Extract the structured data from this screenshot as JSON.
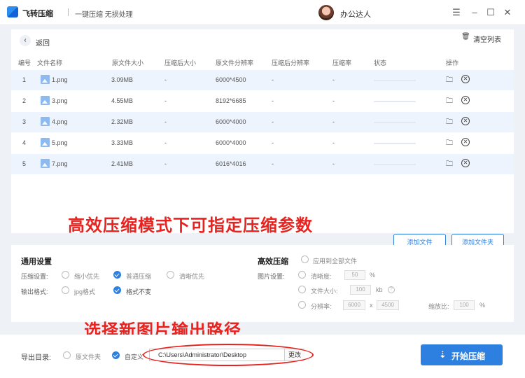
{
  "titlebar": {
    "app_name": "飞转压缩",
    "slogan": "一键压缩 无损处理",
    "username": "办公达人",
    "minimize_icon": "minimize-icon",
    "maximize_icon": "maximize-icon",
    "close_icon": "close-icon"
  },
  "main": {
    "back_label": "返回",
    "clear_label": "清空列表",
    "columns": [
      "编号",
      "文件名称",
      "原文件大小",
      "压缩后大小",
      "原文件分辨率",
      "压缩后分辨率",
      "压缩率",
      "状态",
      "操作"
    ],
    "rows": [
      {
        "no": "1",
        "name": "1.png",
        "size": "3.09MB",
        "compressed": "-",
        "res": "6000*4500",
        "new_res": "-",
        "ratio": "-"
      },
      {
        "no": "2",
        "name": "3.png",
        "size": "4.55MB",
        "compressed": "-",
        "res": "8192*6685",
        "new_res": "-",
        "ratio": "-"
      },
      {
        "no": "3",
        "name": "4.png",
        "size": "2.32MB",
        "compressed": "-",
        "res": "6000*4000",
        "new_res": "-",
        "ratio": "-"
      },
      {
        "no": "4",
        "name": "5.png",
        "size": "3.33MB",
        "compressed": "-",
        "res": "6000*4000",
        "new_res": "-",
        "ratio": "-"
      },
      {
        "no": "5",
        "name": "7.png",
        "size": "2.41MB",
        "compressed": "-",
        "res": "6016*4016",
        "new_res": "-",
        "ratio": "-"
      }
    ],
    "add_file": "添加文件",
    "add_folder": "添加文件夹"
  },
  "overlay": {
    "top": "高效压缩模式下可指定压缩参数",
    "bottom": "选择新图片输出路径"
  },
  "settings": {
    "general_title": "通用设置",
    "compress_label": "压缩设置:",
    "compress_options": [
      "缩小优先",
      "普通压缩",
      "清晰优先"
    ],
    "compress_selected": "普通压缩",
    "format_label": "输出格式:",
    "format_options": [
      "jpg格式",
      "格式不变"
    ],
    "format_selected": "格式不变",
    "advanced_title": "高效压缩",
    "apply_all": "应用到全部文件",
    "image_label": "图片设置:",
    "clarity_label": "清晰度:",
    "clarity_value": "50",
    "clarity_unit": "%",
    "size_label": "文件大小:",
    "size_value": "100",
    "size_unit": "kb",
    "res_label": "分辨率:",
    "res_w": "6000",
    "res_x": "x",
    "res_h": "4500",
    "scale_label": "缩放比:",
    "scale_value": "100",
    "scale_unit": "%"
  },
  "bottom": {
    "export_label": "导出目录:",
    "option_original": "原文件夹",
    "option_custom": "自定义",
    "path": "C:\\Users\\Administrator\\Desktop",
    "change": "更改",
    "start": "开始压缩"
  },
  "colors": {
    "accent": "#2d7fe0",
    "annotation": "#e8231f"
  }
}
